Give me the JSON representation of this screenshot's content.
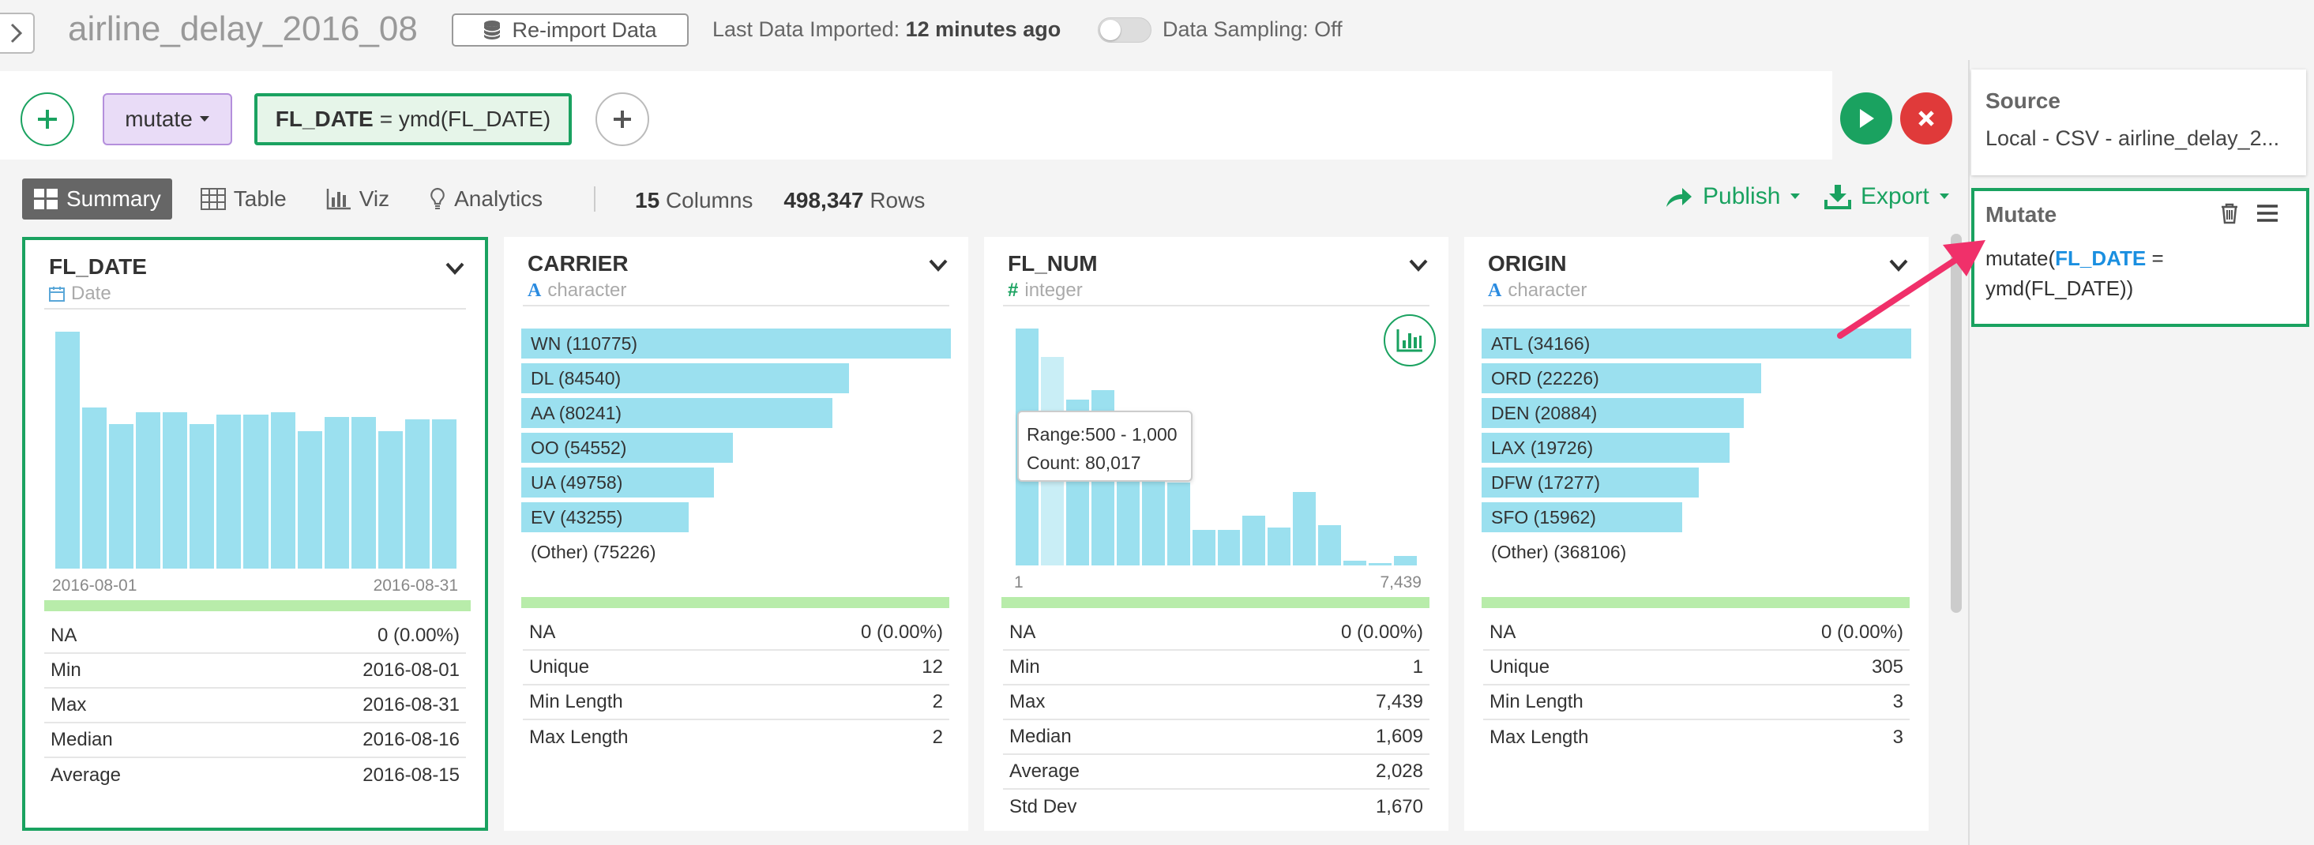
{
  "project_title": "airline_delay_2016_08",
  "topbar": {
    "reimport_label": "Re-import Data",
    "last_imported_label": "Last Data Imported:",
    "last_imported_value": "12 minutes ago",
    "sampling_label": "Data Sampling: Off"
  },
  "command": {
    "verb": "mutate",
    "formula_col": "FL_DATE",
    "formula_rest": "= ymd(FL_DATE)"
  },
  "tabs": [
    {
      "label": "Summary",
      "icon": "summary-icon"
    },
    {
      "label": "Table",
      "icon": "table-icon"
    },
    {
      "label": "Viz",
      "icon": "viz-icon"
    },
    {
      "label": "Analytics",
      "icon": "bulb-icon"
    }
  ],
  "info": {
    "columns": "15",
    "columns_label": "Columns",
    "rows": "498,347",
    "rows_label": "Rows"
  },
  "actions": {
    "publish": "Publish",
    "export": "Export"
  },
  "columns": [
    {
      "name": "FL_DATE",
      "type": "Date",
      "histogram": [
        1,
        0.68,
        0.61,
        0.66,
        0.66,
        0.61,
        0.65,
        0.65,
        0.66,
        0.58,
        0.64,
        0.64,
        0.58,
        0.63,
        0.63
      ],
      "axis_min": "2016-08-01",
      "axis_max": "2016-08-31",
      "stats": [
        [
          "NA",
          "0 (0.00%)"
        ],
        [
          "Min",
          "2016-08-01"
        ],
        [
          "Max",
          "2016-08-31"
        ],
        [
          "Median",
          "2016-08-16"
        ],
        [
          "Average",
          "2016-08-15"
        ]
      ]
    },
    {
      "name": "CARRIER",
      "type": "character",
      "top": [
        [
          "WN (110775)",
          1
        ],
        [
          "DL (84540)",
          0.763
        ],
        [
          "AA (80241)",
          0.724
        ],
        [
          "OO (54552)",
          0.492
        ],
        [
          "UA (49758)",
          0.449
        ],
        [
          "EV (43255)",
          0.39
        ]
      ],
      "other": "(Other) (75226)",
      "stats": [
        [
          "NA",
          "0 (0.00%)"
        ],
        [
          "Unique",
          "12"
        ],
        [
          "Min Length",
          "2"
        ],
        [
          "Max Length",
          "2"
        ]
      ]
    },
    {
      "name": "FL_NUM",
      "type": "integer",
      "histogram": [
        1,
        0.88,
        0.7,
        0.74,
        0.44,
        0.43,
        0.35,
        0.15,
        0.15,
        0.21,
        0.16,
        0.31,
        0.17,
        0.02,
        0.01,
        0.04
      ],
      "axis_min": "1",
      "axis_max": "7,439",
      "stats": [
        [
          "NA",
          "0 (0.00%)"
        ],
        [
          "Min",
          "1"
        ],
        [
          "Max",
          "7,439"
        ],
        [
          "Median",
          "1,609"
        ],
        [
          "Average",
          "2,028"
        ],
        [
          "Std Dev",
          "1,670"
        ]
      ]
    },
    {
      "name": "ORIGIN",
      "type": "character",
      "top": [
        [
          "ATL (34166)",
          1
        ],
        [
          "ORD (22226)",
          0.65
        ],
        [
          "DEN (20884)",
          0.611
        ],
        [
          "LAX (19726)",
          0.577
        ],
        [
          "DFW (17277)",
          0.506
        ],
        [
          "SFO (15962)",
          0.467
        ]
      ],
      "other": "(Other) (368106)",
      "stats": [
        [
          "NA",
          "0 (0.00%)"
        ],
        [
          "Unique",
          "305"
        ],
        [
          "Min Length",
          "3"
        ],
        [
          "Max Length",
          "3"
        ]
      ]
    }
  ],
  "tooltip": {
    "range_label": "Range:",
    "range": "500 - 1,000",
    "count_label": "Count:",
    "count": "80,017"
  },
  "right_panel": {
    "source_title": "Source",
    "source_desc": "Local - CSV - airline_delay_2...",
    "mutate_title": "Mutate",
    "mutate_prefix": "mutate(",
    "mutate_col": "FL_DATE",
    "mutate_eq": " =",
    "mutate_rest": "ymd(FL_DATE))"
  },
  "colors": {
    "accent": "#1aa260",
    "bar": "#9be0ef",
    "na_bar": "#b8ecaa",
    "danger": "#e03a3a",
    "arrow": "#f0306a",
    "highlight": "#1a8fe0"
  }
}
